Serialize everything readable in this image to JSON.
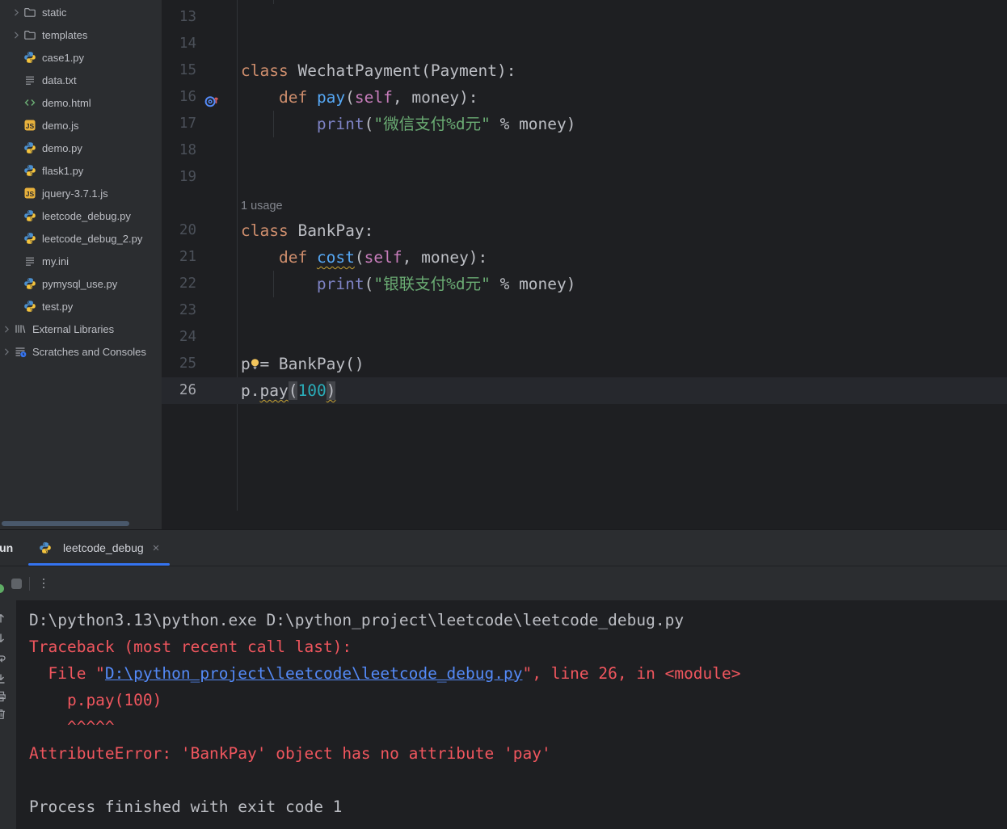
{
  "colors": {
    "accent": "#3574F0",
    "err": "#F0565E",
    "link": "#548AF7",
    "kw": "#CF8E6D",
    "fn": "#56A8F5",
    "slf": "#C77DBB",
    "bi": "#7D82C4",
    "str": "#6AAB73",
    "nm": "#2AACB8"
  },
  "sidebar": {
    "items": [
      {
        "label": "static",
        "icon": "folder",
        "chevron": true,
        "level": 1
      },
      {
        "label": "templates",
        "icon": "folder",
        "chevron": true,
        "level": 1
      },
      {
        "label": "case1.py",
        "icon": "python",
        "chevron": false,
        "level": 1
      },
      {
        "label": "data.txt",
        "icon": "text",
        "chevron": false,
        "level": 1
      },
      {
        "label": "demo.html",
        "icon": "html",
        "chevron": false,
        "level": 1
      },
      {
        "label": "demo.js",
        "icon": "js",
        "chevron": false,
        "level": 1
      },
      {
        "label": "demo.py",
        "icon": "python",
        "chevron": false,
        "level": 1
      },
      {
        "label": "flask1.py",
        "icon": "python",
        "chevron": false,
        "level": 1
      },
      {
        "label": "jquery-3.7.1.js",
        "icon": "js",
        "chevron": false,
        "level": 1
      },
      {
        "label": "leetcode_debug.py",
        "icon": "python",
        "chevron": false,
        "level": 1
      },
      {
        "label": "leetcode_debug_2.py",
        "icon": "python",
        "chevron": false,
        "level": 1
      },
      {
        "label": "my.ini",
        "icon": "text",
        "chevron": false,
        "level": 1
      },
      {
        "label": "pymysql_use.py",
        "icon": "python",
        "chevron": false,
        "level": 1
      },
      {
        "label": "test.py",
        "icon": "python",
        "chevron": false,
        "level": 1
      },
      {
        "label": "External Libraries",
        "icon": "lib",
        "chevron": true,
        "level": 0
      },
      {
        "label": "Scratches and Consoles",
        "icon": "scratch",
        "chevron": true,
        "level": 0
      }
    ]
  },
  "editor": {
    "lines": [
      {
        "num": "13",
        "tokens": []
      },
      {
        "num": "14",
        "tokens": []
      },
      {
        "num": "15",
        "tokens": [
          {
            "t": "class ",
            "c": "kw"
          },
          {
            "t": "WechatPayment(Payment):",
            "c": "df"
          }
        ]
      },
      {
        "num": "16",
        "gutter_icon": "recursion",
        "tokens": [
          {
            "t": "    ",
            "c": "df"
          },
          {
            "t": "def ",
            "c": "kw"
          },
          {
            "t": "pay",
            "c": "fn"
          },
          {
            "t": "(",
            "c": "df"
          },
          {
            "t": "self",
            "c": "slf"
          },
          {
            "t": ", money):",
            "c": "df"
          }
        ]
      },
      {
        "num": "17",
        "tokens": [
          {
            "t": "        ",
            "c": "df"
          },
          {
            "t": "print",
            "c": "bi"
          },
          {
            "t": "(",
            "c": "df"
          },
          {
            "t": "\"微信支付%d元\"",
            "c": "str"
          },
          {
            "t": " % money)",
            "c": "df"
          }
        ]
      },
      {
        "num": "18",
        "tokens": []
      },
      {
        "num": "19",
        "tokens": []
      },
      {
        "num": "",
        "inlay": "1 usage",
        "tokens": []
      },
      {
        "num": "20",
        "tokens": [
          {
            "t": "class ",
            "c": "kw"
          },
          {
            "t": "BankPay:",
            "c": "df"
          }
        ]
      },
      {
        "num": "21",
        "tokens": [
          {
            "t": "    ",
            "c": "df"
          },
          {
            "t": "def ",
            "c": "kw"
          },
          {
            "t": "cost",
            "c": "fn wv"
          },
          {
            "t": "(",
            "c": "df"
          },
          {
            "t": "self",
            "c": "slf"
          },
          {
            "t": ", money):",
            "c": "df"
          }
        ]
      },
      {
        "num": "22",
        "tokens": [
          {
            "t": "        ",
            "c": "df"
          },
          {
            "t": "print",
            "c": "bi"
          },
          {
            "t": "(",
            "c": "df"
          },
          {
            "t": "\"银联支付%d元\"",
            "c": "str"
          },
          {
            "t": " % money)",
            "c": "df"
          }
        ]
      },
      {
        "num": "23",
        "tokens": []
      },
      {
        "num": "24",
        "tokens": []
      },
      {
        "num": "25",
        "tokens": [
          {
            "t": "p",
            "c": "df"
          },
          {
            "icon": "bulb"
          },
          {
            "t": "= BankPay()",
            "c": "df"
          }
        ]
      },
      {
        "num": "26",
        "current": true,
        "tokens": [
          {
            "t": "p.",
            "c": "df"
          },
          {
            "t": "pay",
            "c": "df wv"
          },
          {
            "t": "(",
            "c": "df bh"
          },
          {
            "t": "100",
            "c": "nm"
          },
          {
            "t": ")",
            "c": "df bh wv"
          }
        ]
      }
    ]
  },
  "run_panel": {
    "tool_label": "Run",
    "tab": {
      "label": "leetcode_debug",
      "close": "×"
    },
    "strip_icons": [
      "scroll-up",
      "scroll-down",
      "soft-wrap",
      "scroll-to-end",
      "print",
      "clear"
    ]
  },
  "console": {
    "lines": [
      [
        {
          "t": "D:\\python3.13\\python.exe D:\\python_project\\leetcode\\leetcode_debug.py",
          "c": "out"
        }
      ],
      [
        {
          "t": "Traceback (most recent call last):",
          "c": "err"
        }
      ],
      [
        {
          "t": "  File \"",
          "c": "err"
        },
        {
          "t": "D:\\python_project\\leetcode\\leetcode_debug.py",
          "c": "link"
        },
        {
          "t": "\", line 26, in <module>",
          "c": "err"
        }
      ],
      [
        {
          "t": "    p.pay(100)",
          "c": "err"
        }
      ],
      [
        {
          "t": "    ^^^^^",
          "c": "err"
        }
      ],
      [
        {
          "t": "AttributeError: 'BankPay' object has no attribute 'pay'",
          "c": "err"
        }
      ],
      [],
      [
        {
          "t": "Process finished with exit code 1",
          "c": "out"
        }
      ]
    ]
  }
}
